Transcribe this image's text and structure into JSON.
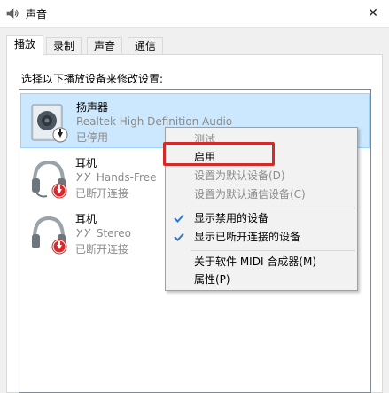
{
  "window": {
    "title": "声音",
    "close_glyph": "✕"
  },
  "tabs": [
    {
      "label": "播放"
    },
    {
      "label": "录制"
    },
    {
      "label": "声音"
    },
    {
      "label": "通信"
    }
  ],
  "instruction": "选择以下播放设备来修改设置:",
  "devices": [
    {
      "name": "扬声器",
      "description": "Realtek High Definition Audio",
      "status": "已停用",
      "icon": "speaker-icon",
      "badge": "down-arrow-badge",
      "selected": true
    },
    {
      "name": "耳机",
      "description": "Hands-Free",
      "status": "已断开连接",
      "icon": "headset-icon",
      "badge": "red-down-arrow-badge",
      "selected": false
    },
    {
      "name": "耳机",
      "description": "Stereo",
      "status": "已断开连接",
      "icon": "headphones-icon",
      "badge": "red-down-arrow-badge",
      "selected": false
    }
  ],
  "context_menu": {
    "items": [
      {
        "label": "测试",
        "disabled": true,
        "checked": false
      },
      {
        "label": "启用",
        "disabled": false,
        "checked": false
      },
      {
        "label": "设置为默认设备(D)",
        "disabled": true,
        "checked": false
      },
      {
        "label": "设置为默认通信设备(C)",
        "disabled": true,
        "checked": false
      },
      {
        "label": "显示禁用的设备",
        "disabled": false,
        "checked": true
      },
      {
        "label": "显示已断开连接的设备",
        "disabled": false,
        "checked": true
      },
      {
        "label": "关于软件 MIDI 合成器(M)",
        "disabled": false,
        "checked": false
      },
      {
        "label": "属性(P)",
        "disabled": false,
        "checked": false
      }
    ]
  },
  "colors": {
    "selection_bg": "#cce8ff",
    "selection_border": "#99d1ff",
    "highlight_box": "#d42a2a",
    "check_blue": "#2b78d8",
    "disabled_text": "#8d8d8d"
  }
}
